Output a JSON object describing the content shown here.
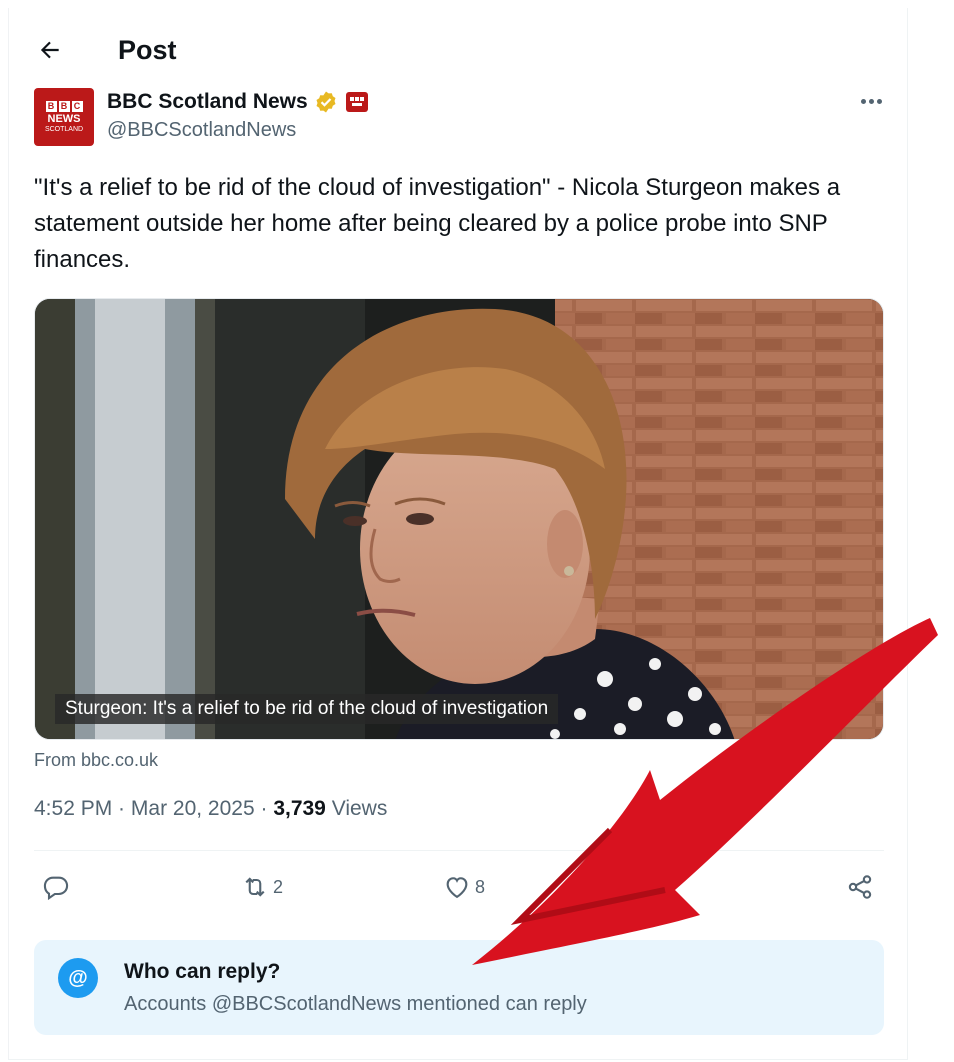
{
  "header": {
    "title": "Post"
  },
  "author": {
    "display_name": "BBC Scotland News",
    "handle": "@BBCScotlandNews",
    "avatar_text": {
      "blocks": [
        "B",
        "B",
        "C"
      ],
      "line1": "NEWS",
      "line2": "SCOTLAND"
    },
    "verified_color": "#e8b923"
  },
  "tweet": {
    "text": "\"It's a relief to be rid of the cloud of investigation\" - Nicola Sturgeon makes a statement outside her home after being cleared by a police probe into SNP finances."
  },
  "media": {
    "caption": "Sturgeon: It's a relief to be rid of the cloud of investigation",
    "source": "From bbc.co.uk"
  },
  "meta": {
    "time": "4:52 PM",
    "sep1": " · ",
    "date": "Mar 20, 2025",
    "sep2": " · ",
    "views_count": "3,739",
    "views_label": " Views"
  },
  "actions": {
    "reposts": "2",
    "likes": "8"
  },
  "reply_restriction": {
    "title": "Who can reply?",
    "description": "Accounts @BBCScotlandNews mentioned can reply",
    "icon": "@"
  },
  "colors": {
    "brand_red": "#bb1919",
    "accent_blue": "#1d9bf0",
    "annotation_arrow": "#d8121f"
  }
}
